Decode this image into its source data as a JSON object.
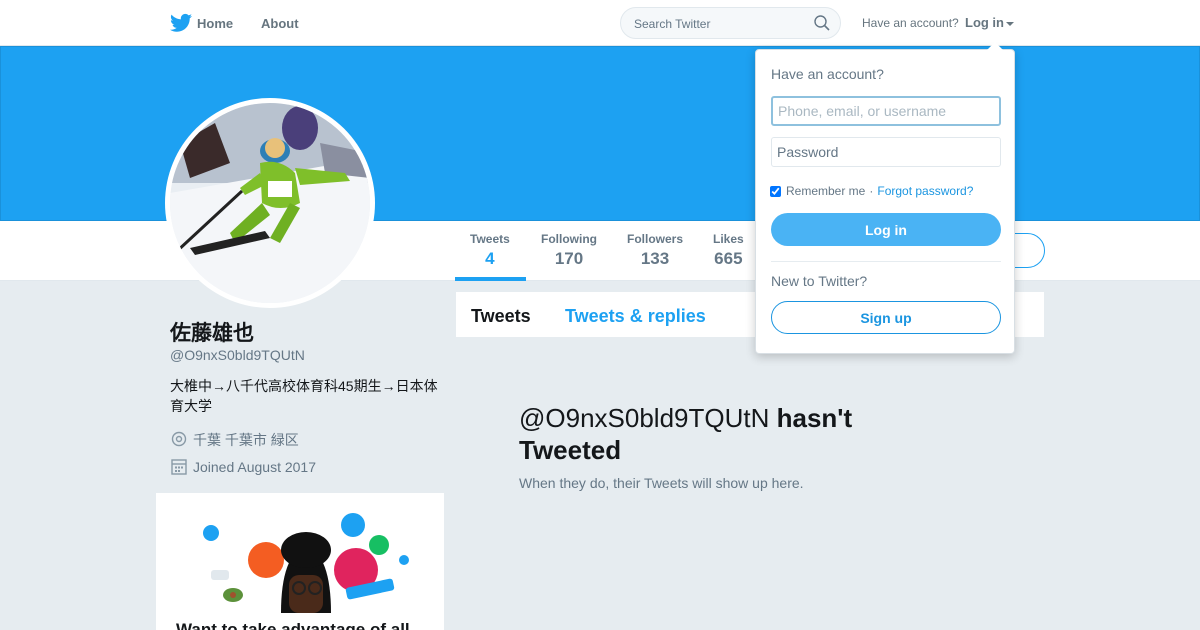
{
  "nav": {
    "home_label": "Home",
    "about_label": "About",
    "search_placeholder": "Search Twitter",
    "have_account": "Have an account?",
    "login_label": "Log in"
  },
  "profile": {
    "name": "佐藤雄也",
    "handle": "@O9nxS0bld9TQUtN",
    "bio": "大椎中→八千代高校体育科45期生→日本体育大学",
    "location": "千葉 千葉市 緑区",
    "joined": "Joined August 2017"
  },
  "stats": [
    {
      "label": "Tweets",
      "value": "4"
    },
    {
      "label": "Following",
      "value": "170"
    },
    {
      "label": "Followers",
      "value": "133"
    },
    {
      "label": "Likes",
      "value": "665"
    }
  ],
  "timeline": {
    "tab_tweets": "Tweets",
    "tab_replies": "Tweets & replies",
    "empty_handle": "@O9nxS0bld9TQUtN",
    "empty_suffix": "hasn't Tweeted",
    "empty_sub": "When they do, their Tweets will show up here."
  },
  "promo": {
    "text": "Want to take advantage of all"
  },
  "login_dropdown": {
    "heading": "Have an account?",
    "username_placeholder": "Phone, email, or username",
    "password_placeholder": "Password",
    "remember_label": "Remember me",
    "separator": "·",
    "forgot_label": "Forgot password?",
    "login_button": "Log in",
    "new_to_twitter": "New to Twitter?",
    "signup_button": "Sign up"
  },
  "colors": {
    "accent": "#1da1f2",
    "banner": "#1da1f2",
    "background": "#e6ecf0"
  }
}
